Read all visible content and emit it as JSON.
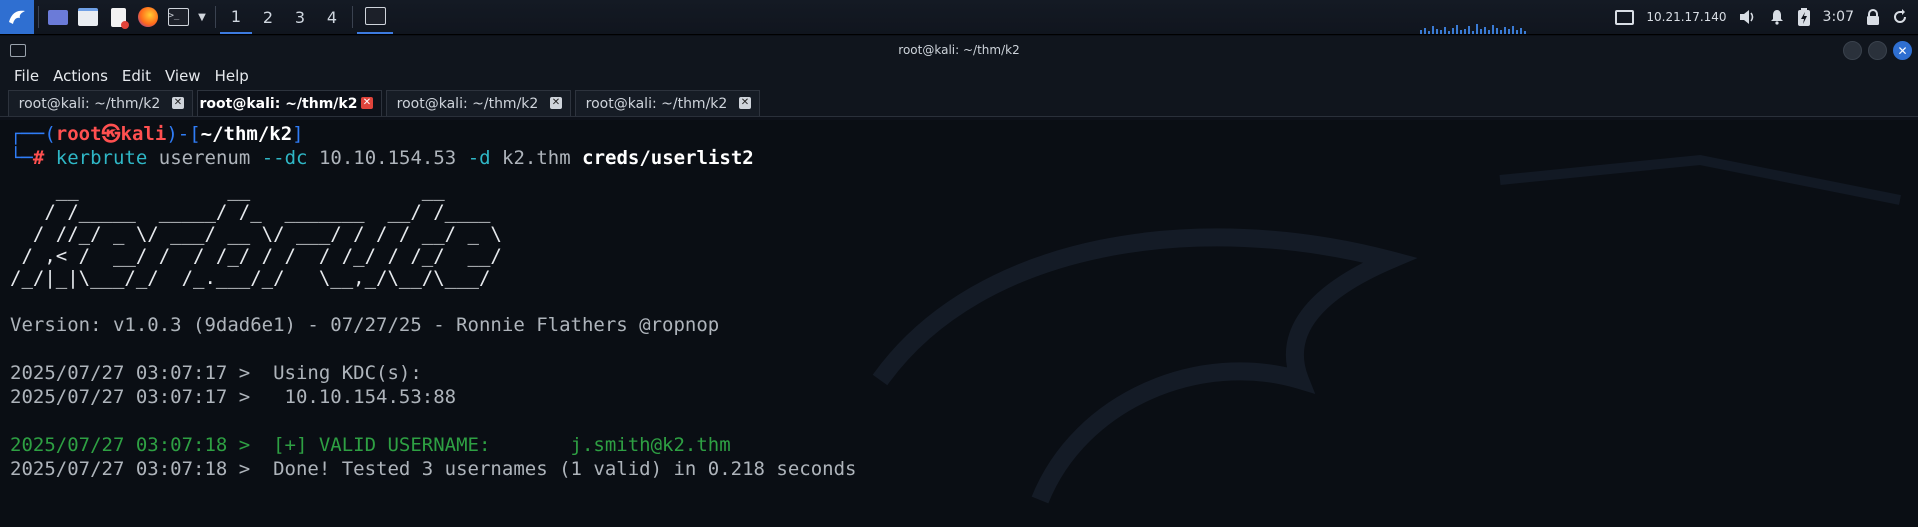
{
  "panel": {
    "workspaces": [
      "1",
      "2",
      "3",
      "4"
    ],
    "ip": "10.21.17.140",
    "clock": "3:07"
  },
  "window": {
    "title": "root@kali: ~/thm/k2",
    "menu": [
      "File",
      "Actions",
      "Edit",
      "View",
      "Help"
    ],
    "tabs": [
      {
        "label": "root@kali: ~/thm/k2",
        "active": false
      },
      {
        "label": "root@kali: ~/thm/k2",
        "active": true
      },
      {
        "label": "root@kali: ~/thm/k2",
        "active": false
      },
      {
        "label": "root@kali: ~/thm/k2",
        "active": false
      }
    ]
  },
  "prompt": {
    "user": "root",
    "skull": "㉿",
    "host": "kali",
    "path": "~/thm/k2",
    "cmd_tool": "kerbrute",
    "cmd_args1": "userenum",
    "cmd_flag1": "--dc",
    "cmd_ip": "10.10.154.53",
    "cmd_flag2": "-d",
    "cmd_domain": "k2.thm",
    "cmd_file": "creds/userlist2"
  },
  "banner": [
    "    __             __               __     ",
    "   / /_____  _____/ /_  _______  __/ /____ ",
    "  / //_/ _ \\/ ___/ __ \\/ ___/ / / / __/ _ \\",
    " / ,< /  __/ /  / /_/ / /  / /_/ / /_/  __/",
    "/_/|_|\\___/_/  /_.___/_/   \\__,_/\\__/\\___/ "
  ],
  "output": {
    "version": "Version: v1.0.3 (9dad6e1) - 07/27/25 - Ronnie Flathers @ropnop",
    "line1": "2025/07/27 03:07:17 >  Using KDC(s):",
    "line2": "2025/07/27 03:07:17 >   10.10.154.53:88",
    "line3": "2025/07/27 03:07:18 >  [+] VALID USERNAME:       j.smith@k2.thm",
    "line4": "2025/07/27 03:07:18 >  Done! Tested 3 usernames (1 valid) in 0.218 seconds"
  },
  "colors": {
    "accent": "#2f6fd1",
    "prompt_blue": "#2f7cf6",
    "prompt_red": "#ff5050",
    "valid_green": "#3fbf4a"
  }
}
